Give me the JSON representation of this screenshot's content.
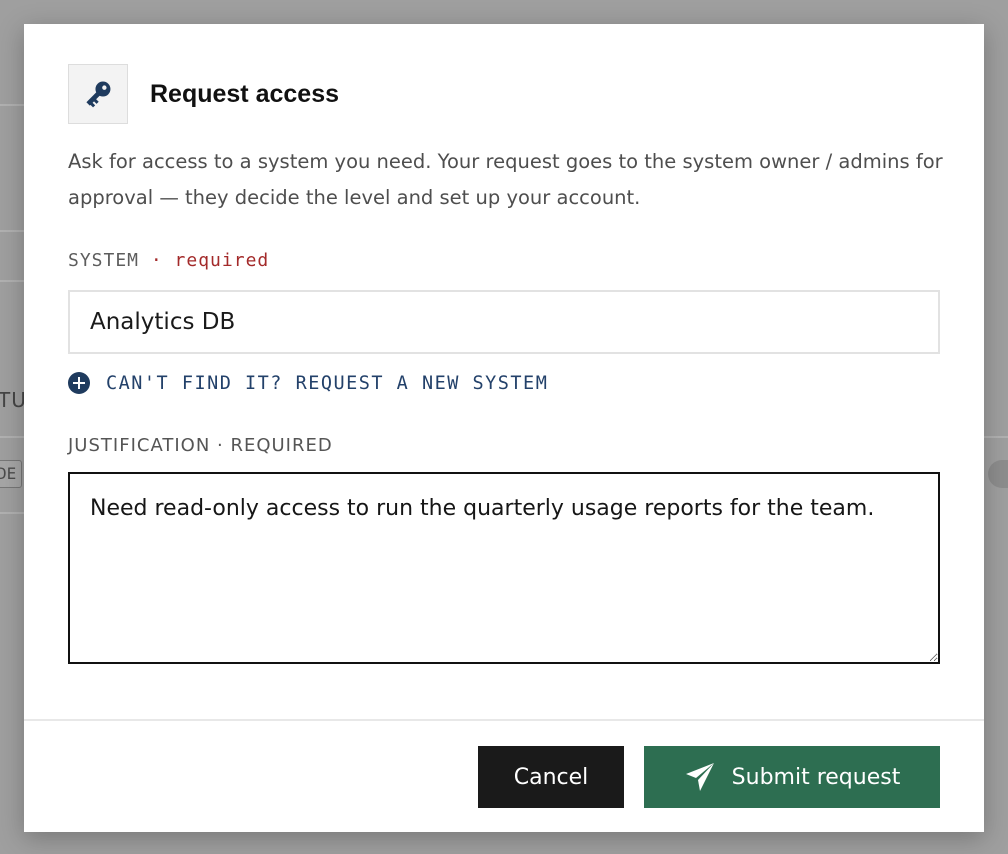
{
  "background": {
    "fragment_left": "TU",
    "chip_left": "DE"
  },
  "modal": {
    "icon": "key-icon",
    "title": "Request access",
    "description": "Ask for access to a system you need. Your request goes to the system owner / admins for approval — they decide the level and set up your account.",
    "system": {
      "label": "SYSTEM",
      "required": "· required",
      "value": "Analytics DB"
    },
    "new_system_link": {
      "icon": "plus-circle-icon",
      "label": "CAN'T FIND IT? REQUEST A NEW SYSTEM"
    },
    "justification": {
      "label": "JUSTIFICATION · REQUIRED",
      "value": "Need read-only access to run the quarterly usage reports for the team."
    },
    "buttons": {
      "cancel": "Cancel",
      "submit": "Submit request",
      "submit_icon": "send-icon"
    }
  },
  "colors": {
    "accent_submit": "#2d6e51",
    "cancel_button": "#1a1a1a",
    "required": "#a32a2a",
    "link": "#23416a"
  }
}
